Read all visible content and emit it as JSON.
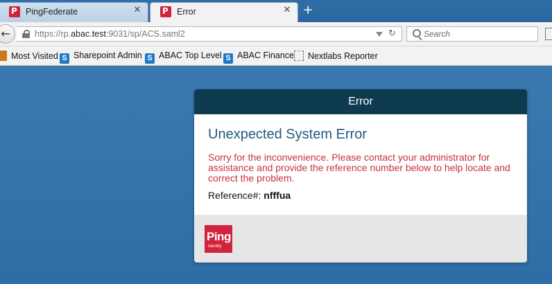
{
  "browser": {
    "tabs": [
      {
        "title": "PingFederate",
        "active": false
      },
      {
        "title": "Error",
        "active": true
      }
    ],
    "new_tab_symbol": "+",
    "close_symbol": "✕",
    "url": {
      "prefix": "https://rp.",
      "domain": "abac.test",
      "suffix": ":9031/sp/ACS.saml2"
    },
    "search_placeholder": "Search",
    "bookmarks": [
      {
        "label": "Most Visited",
        "icon": "folder-icon"
      },
      {
        "label": "Sharepoint Admin",
        "icon": "sharepoint-icon"
      },
      {
        "label": "ABAC Top Level",
        "icon": "sharepoint-icon"
      },
      {
        "label": "ABAC Finance",
        "icon": "sharepoint-icon"
      },
      {
        "label": "Nextlabs Reporter",
        "icon": "blank-page-icon"
      }
    ]
  },
  "error_card": {
    "header": "Error",
    "title": "Unexpected System Error",
    "message": "Sorry for the inconvenience. Please contact your administrator for assistance and provide the reference number below to help locate and correct the problem.",
    "reference_label": "Reference#:",
    "reference_value": "nfffua",
    "logo_text": "Ping",
    "logo_subtext": "Identity"
  },
  "colors": {
    "page_background": "#2f6ea6",
    "card_header": "#0e3b50",
    "title_text": "#1e5a7e",
    "message_text": "#c8303c",
    "logo": "#d2233c"
  }
}
